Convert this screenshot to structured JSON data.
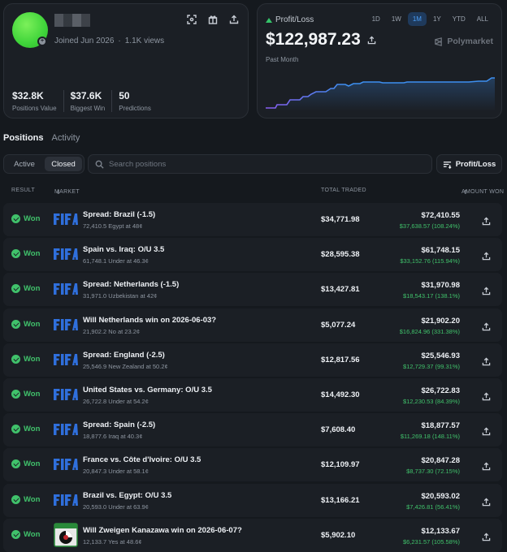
{
  "profile": {
    "joined": "Joined Jun 2026",
    "views": "1.1K views",
    "stats": [
      {
        "value": "$32.8K",
        "label": "Positions Value"
      },
      {
        "value": "$37.6K",
        "label": "Biggest Win"
      },
      {
        "value": "50",
        "label": "Predictions"
      }
    ]
  },
  "pnl": {
    "label": "Profit/Loss",
    "value": "$122,987.23",
    "period": "Past Month",
    "brand": "Polymarket",
    "ranges": [
      "1D",
      "1W",
      "1M",
      "1Y",
      "YTD",
      "ALL"
    ],
    "active_range": "1M"
  },
  "tabs": [
    "Positions",
    "Activity"
  ],
  "filter": {
    "options": [
      "Active",
      "Closed"
    ],
    "active": "Closed"
  },
  "search": {
    "placeholder": "Search positions"
  },
  "sort_button": "Profit/Loss",
  "table": {
    "headers": {
      "result": "RESULT",
      "market": "MARKET",
      "total": "TOTAL TRADED",
      "amount": "AMOUNT WON"
    },
    "rows": [
      {
        "result": "Won",
        "logo": "fifa",
        "title": "Spread: Brazil (-1.5)",
        "sub": "72,410.5 Egypt at 48¢",
        "total": "$34,771.98",
        "amount": "$72,410.55",
        "profit": "$37,638.57 (108.24%)"
      },
      {
        "result": "Won",
        "logo": "fifa",
        "title": "Spain vs. Iraq: O/U 3.5",
        "sub": "61,748.1 Under at 46.3¢",
        "total": "$28,595.38",
        "amount": "$61,748.15",
        "profit": "$33,152.76 (115.94%)"
      },
      {
        "result": "Won",
        "logo": "fifa",
        "title": "Spread: Netherlands (-1.5)",
        "sub": "31,971.0 Uzbekistan at 42¢",
        "total": "$13,427.81",
        "amount": "$31,970.98",
        "profit": "$18,543.17 (138.1%)"
      },
      {
        "result": "Won",
        "logo": "fifa",
        "title": "Will Netherlands win on 2026-06-03?",
        "sub": "21,902.2 No at 23.2¢",
        "total": "$5,077.24",
        "amount": "$21,902.20",
        "profit": "$16,824.96 (331.38%)"
      },
      {
        "result": "Won",
        "logo": "fifa",
        "title": "Spread: England (-2.5)",
        "sub": "25,546.9 New Zealand at 50.2¢",
        "total": "$12,817.56",
        "amount": "$25,546.93",
        "profit": "$12,729.37 (99.31%)"
      },
      {
        "result": "Won",
        "logo": "fifa",
        "title": "United States vs. Germany: O/U 3.5",
        "sub": "26,722.8 Under at 54.2¢",
        "total": "$14,492.30",
        "amount": "$26,722.83",
        "profit": "$12,230.53 (84.39%)"
      },
      {
        "result": "Won",
        "logo": "fifa",
        "title": "Spread: Spain (-2.5)",
        "sub": "18,877.6 Iraq at 40.3¢",
        "total": "$7,608.40",
        "amount": "$18,877.57",
        "profit": "$11,269.18 (148.11%)"
      },
      {
        "result": "Won",
        "logo": "fifa",
        "title": "France vs. Côte d'Ivoire: O/U 3.5",
        "sub": "20,847.3 Under at 58.1¢",
        "total": "$12,109.97",
        "amount": "$20,847.28",
        "profit": "$8,737.30 (72.15%)"
      },
      {
        "result": "Won",
        "logo": "fifa",
        "title": "Brazil vs. Egypt: O/U 3.5",
        "sub": "20,593.0 Under at 63.9¢",
        "total": "$13,166.21",
        "amount": "$20,593.02",
        "profit": "$7,426.81 (56.41%)"
      },
      {
        "result": "Won",
        "logo": "club",
        "title": "Will Zweigen Kanazawa win on 2026-06-07?",
        "sub": "12,133.7 Yes at 48.6¢",
        "total": "$5,902.10",
        "amount": "$12,133.67",
        "profit": "$6,231.57 (105.58%)"
      }
    ]
  },
  "colors": {
    "accent": "#4b9ef5",
    "positive": "#40c26b",
    "chart_start": "#8a5cf0",
    "chart_end": "#3d8ff0"
  }
}
